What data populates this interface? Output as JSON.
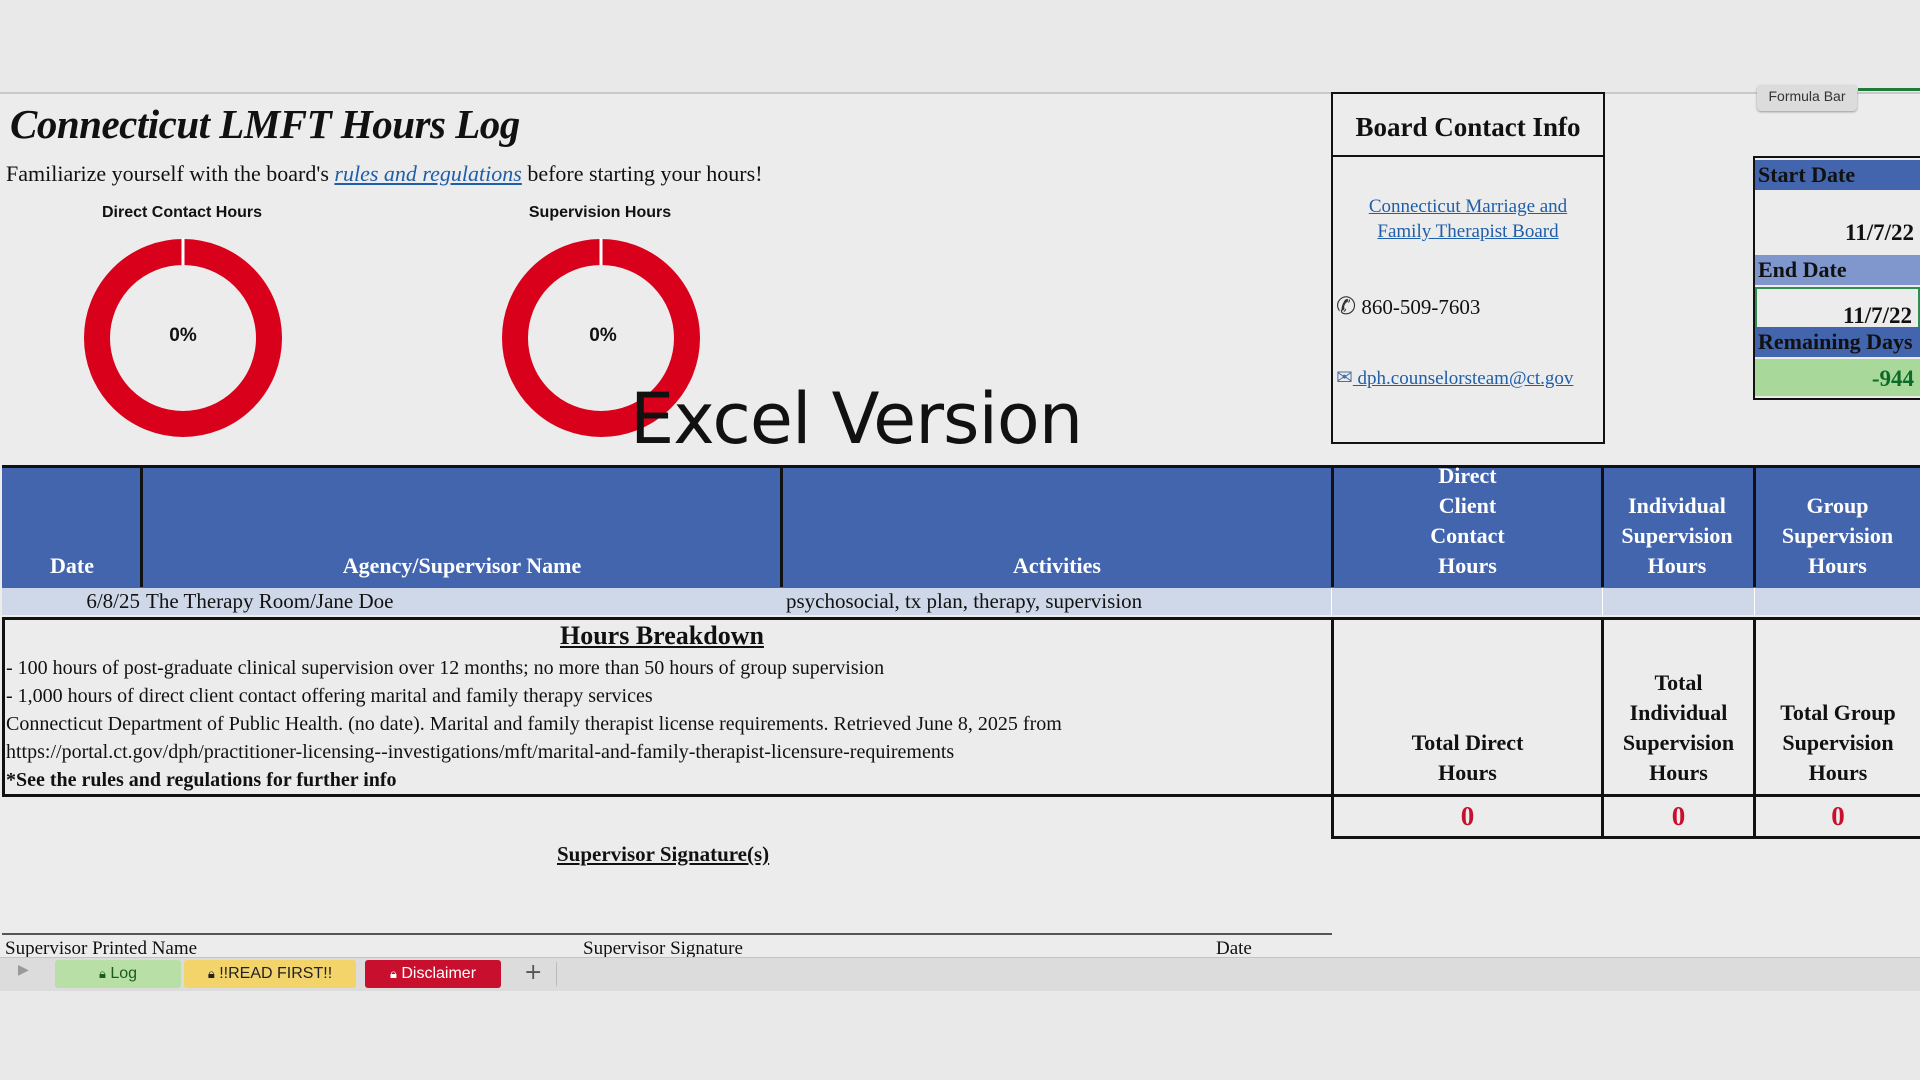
{
  "title": "Connecticut LMFT Hours Log",
  "intro": {
    "before": "Familiarize yourself with the board's ",
    "link": "rules and regulations",
    "after": " before starting your hours!"
  },
  "charts": [
    {
      "label": "Direct Contact Hours",
      "percent_text": "0%",
      "percent": 0
    },
    {
      "label": "Supervision Hours",
      "percent_text": "0%",
      "percent": 0
    }
  ],
  "overlay_caption": "Excel Version",
  "board": {
    "title": "Board Contact Info",
    "link": "Connecticut Marriage and Family Therapist Board",
    "phone": "860-509-7603",
    "email": "dph.counselorsteam@ct.gov"
  },
  "formula_bar_label": "Formula Bar",
  "date_panel": {
    "start_label": "Start Date",
    "start_value": "11/7/22",
    "end_label": "End Date",
    "end_value": "11/7/22",
    "remaining_label": "Remaining Days",
    "remaining_value": "-944"
  },
  "table": {
    "headers": {
      "date": "Date",
      "agency": "Agency/Supervisor Name",
      "activities": "Activities",
      "direct": "Direct Client Contact Hours",
      "individual": "Individual Supervision Hours",
      "group": "Group Supervision Hours"
    },
    "rows": [
      {
        "date": "6/8/25",
        "agency": "The Therapy Room/Jane Doe",
        "activities": "psychosocial, tx plan, therapy, supervision",
        "direct": "",
        "individual": "",
        "group": ""
      }
    ]
  },
  "breakdown": {
    "title": "Hours Breakdown",
    "lines": [
      "- 100 hours of post-graduate clinical supervision over 12 months; no more than 50 hours of group supervision",
      "- 1,000 hours of direct client contact offering marital and family therapy services",
      "Connecticut Department of Public Health. (no date). Marital and family therapist license requirements. Retrieved June 8, 2025 from",
      "https://portal.ct.gov/dph/practitioner-licensing--investigations/mft/marital-and-family-therapist-licensure-requirements"
    ],
    "note": "*See the rules and regulations for further info"
  },
  "totals": {
    "direct_label": "Total Direct Hours",
    "individual_label": "Total Individual Supervision Hours",
    "group_label": "Total Group Supervision Hours",
    "direct_value": "0",
    "individual_value": "0",
    "group_value": "0"
  },
  "signatures": {
    "title": "Supervisor Signature(s)",
    "printed_name": "Supervisor Printed Name",
    "signature": "Supervisor Signature",
    "date": "Date"
  },
  "tabs": [
    {
      "label": "Log",
      "color": "#b7dfa6",
      "icon": "lock-icon"
    },
    {
      "label": "!!READ FIRST!!",
      "color": "#f2d46b",
      "icon": "lock-icon"
    },
    {
      "label": "Disclaimer",
      "color": "#c8102e",
      "icon": "lock-icon"
    }
  ],
  "add_tab": "+",
  "colors": {
    "header_blue": "#4365ad",
    "donut_red": "#d8001a",
    "total_red": "#c8102e",
    "remaining_green": "#a9d99a",
    "link_blue": "#1f5ea8"
  }
}
